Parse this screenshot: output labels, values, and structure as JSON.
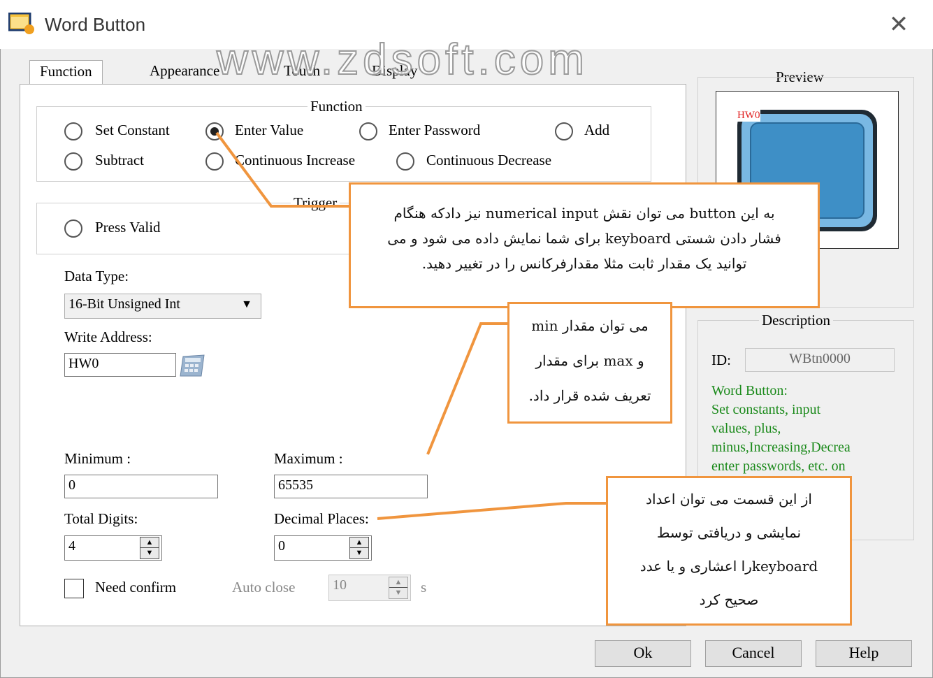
{
  "window": {
    "title": "Word Button",
    "watermark": "www.zdsoft.com"
  },
  "tabs": [
    {
      "label": "Function",
      "active": true
    },
    {
      "label": "Appearance",
      "active": false
    },
    {
      "label": "Touch",
      "active": false
    },
    {
      "label": "Display",
      "active": false
    }
  ],
  "function_group": {
    "title": "Function",
    "options": [
      "Set Constant",
      "Enter Value",
      "Enter Password",
      "Add",
      "Subtract",
      "Continuous Increase",
      "Continuous Decrease"
    ],
    "selected": "Enter Value"
  },
  "trigger_group": {
    "title": "Trigger",
    "option": "Press Valid"
  },
  "data_type": {
    "label": "Data Type:",
    "value": "16-Bit Unsigned Int"
  },
  "write_address": {
    "label": "Write Address:",
    "value": "HW0"
  },
  "minimum": {
    "label": "Minimum :",
    "value": "0"
  },
  "maximum": {
    "label": "Maximum :",
    "value": "65535"
  },
  "total_digits": {
    "label": "Total  Digits:",
    "value": "4"
  },
  "decimal_places": {
    "label": "Decimal Places:",
    "value": "0"
  },
  "need_confirm": {
    "label": "Need confirm",
    "checked": false
  },
  "auto_close": {
    "label": "Auto close",
    "value": "10",
    "unit": "s"
  },
  "preview": {
    "title": "Preview",
    "tag": "HW0"
  },
  "description": {
    "title": "Description",
    "id_label": "ID:",
    "id_value": "WBtn0000",
    "heading": "Word Button:",
    "lines": [
      "Set constants, input",
      "values, plus,",
      "minus,Increasing,Decrea",
      "enter passwords, etc. on"
    ]
  },
  "buttons": {
    "ok": "Ok",
    "cancel": "Cancel",
    "help": "Help"
  },
  "callouts": {
    "enter_value_lines": [
      "به این button می توان نقش numerical input نیز دادکه هنگام",
      "فشار دادن شستی  keyboard برای شما نمایش داده می شود و می",
      "توانید یک مقدار ثابت مثلا مقدارفرکانس را در تغییر دهید."
    ],
    "minmax_lines": [
      "می توان مقدار min",
      "و max برای مقدار",
      "تعریف شده قرار داد."
    ],
    "decimal_lines": [
      "از این قسمت می توان اعداد",
      "نمایشی و دریافتی توسط",
      "keyboardرا اعشاری و یا عدد",
      "صحیح کرد"
    ]
  },
  "colors": {
    "callout_border": "#f0953e",
    "preview_button": "#3e8fc6",
    "preview_border": "#1f2a33"
  }
}
